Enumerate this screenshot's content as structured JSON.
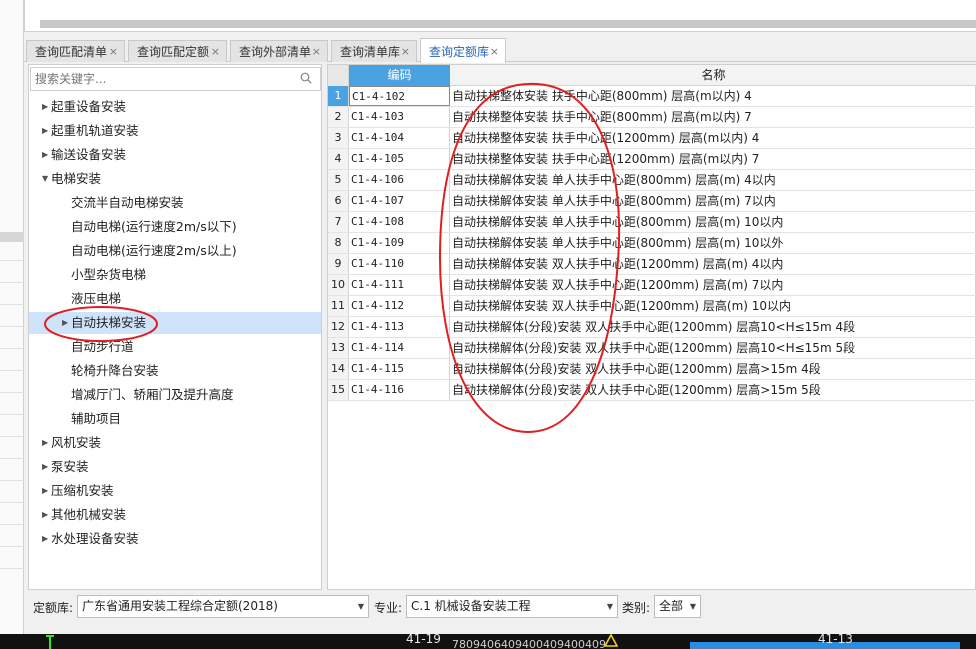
{
  "tabs": [
    {
      "label": "查询匹配清单",
      "close": "×"
    },
    {
      "label": "查询匹配定额",
      "close": "×"
    },
    {
      "label": "查询外部清单",
      "close": "×"
    },
    {
      "label": "查询清单库",
      "close": "×"
    },
    {
      "label": "查询定额库",
      "close": "×",
      "active": true
    }
  ],
  "search": {
    "placeholder": "搜索关键字..."
  },
  "tree": [
    {
      "label": "起重设备安装",
      "level": 0,
      "expanded": false
    },
    {
      "label": "起重机轨道安装",
      "level": 0,
      "expanded": false
    },
    {
      "label": "输送设备安装",
      "level": 0,
      "expanded": false
    },
    {
      "label": "电梯安装",
      "level": 0,
      "expanded": true
    },
    {
      "label": "交流半自动电梯安装",
      "level": 1
    },
    {
      "label": "自动电梯(运行速度2m/s以下)",
      "level": 1
    },
    {
      "label": "自动电梯(运行速度2m/s以上)",
      "level": 1
    },
    {
      "label": "小型杂货电梯",
      "level": 1
    },
    {
      "label": "液压电梯",
      "level": 1
    },
    {
      "label": "自动扶梯安装",
      "level": 1,
      "selected": true,
      "has_children": true
    },
    {
      "label": "自动步行道",
      "level": 1
    },
    {
      "label": "轮椅升降台安装",
      "level": 1
    },
    {
      "label": "增减厅门、轿厢门及提升高度",
      "level": 1
    },
    {
      "label": "辅助项目",
      "level": 1
    },
    {
      "label": "风机安装",
      "level": 0,
      "expanded": false
    },
    {
      "label": "泵安装",
      "level": 0,
      "expanded": false
    },
    {
      "label": "压缩机安装",
      "level": 0,
      "expanded": false
    },
    {
      "label": "其他机械安装",
      "level": 0,
      "expanded": false
    },
    {
      "label": "水处理设备安装",
      "level": 0,
      "expanded": false
    }
  ],
  "grid": {
    "headers": {
      "code": "编码",
      "name": "名称"
    },
    "rows": [
      {
        "num": "1",
        "code": "C1-4-102",
        "name": "自动扶梯整体安装 扶手中心距(800mm) 层高(m以内) 4"
      },
      {
        "num": "2",
        "code": "C1-4-103",
        "name": "自动扶梯整体安装 扶手中心距(800mm) 层高(m以内) 7"
      },
      {
        "num": "3",
        "code": "C1-4-104",
        "name": "自动扶梯整体安装 扶手中心距(1200mm) 层高(m以内) 4"
      },
      {
        "num": "4",
        "code": "C1-4-105",
        "name": "自动扶梯整体安装 扶手中心距(1200mm) 层高(m以内) 7"
      },
      {
        "num": "5",
        "code": "C1-4-106",
        "name": "自动扶梯解体安装 单人扶手中心距(800mm) 层高(m) 4以内"
      },
      {
        "num": "6",
        "code": "C1-4-107",
        "name": "自动扶梯解体安装 单人扶手中心距(800mm) 层高(m) 7以内"
      },
      {
        "num": "7",
        "code": "C1-4-108",
        "name": "自动扶梯解体安装 单人扶手中心距(800mm) 层高(m) 10以内"
      },
      {
        "num": "8",
        "code": "C1-4-109",
        "name": "自动扶梯解体安装 单人扶手中心距(800mm) 层高(m) 10以外"
      },
      {
        "num": "9",
        "code": "C1-4-110",
        "name": "自动扶梯解体安装 双人扶手中心距(1200mm) 层高(m) 4以内"
      },
      {
        "num": "10",
        "code": "C1-4-111",
        "name": "自动扶梯解体安装 双人扶手中心距(1200mm) 层高(m) 7以内"
      },
      {
        "num": "11",
        "code": "C1-4-112",
        "name": "自动扶梯解体安装 双人扶手中心距(1200mm) 层高(m) 10以内"
      },
      {
        "num": "12",
        "code": "C1-4-113",
        "name": "自动扶梯解体(分段)安装 双人扶手中心距(1200mm) 层高10<H≤15m 4段"
      },
      {
        "num": "13",
        "code": "C1-4-114",
        "name": "自动扶梯解体(分段)安装 双人扶手中心距(1200mm) 层高10<H≤15m 5段"
      },
      {
        "num": "14",
        "code": "C1-4-115",
        "name": "自动扶梯解体(分段)安装 双人扶手中心距(1200mm) 层高>15m 4段"
      },
      {
        "num": "15",
        "code": "C1-4-116",
        "name": "自动扶梯解体(分段)安装 双人扶手中心距(1200mm) 层高>15m 5段"
      }
    ]
  },
  "filters": {
    "quota_label": "定额库:",
    "quota_value": "广东省通用安装工程综合定额(2018)",
    "major_label": "专业:",
    "major_value": "C.1 机械设备安装工程",
    "category_label": "类别:",
    "category_value": "全部"
  },
  "statusbar": {
    "left_code": "41-19",
    "right_code": "41-13",
    "digits": "7809406409400409400409"
  },
  "colors": {
    "accent": "#4aa2e2",
    "selection": "#cfe3fb",
    "annotation": "#e02020"
  }
}
